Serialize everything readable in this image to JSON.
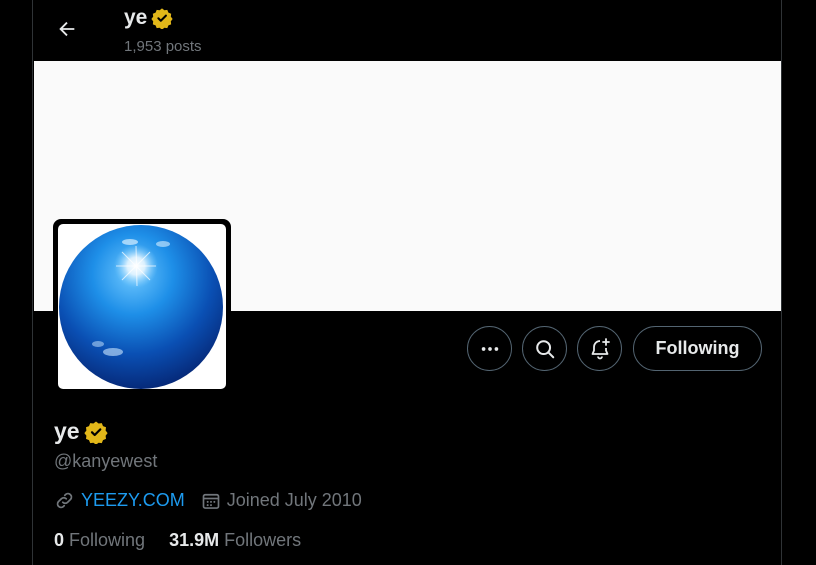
{
  "header": {
    "name": "ye",
    "post_count": "1,953 posts"
  },
  "profile": {
    "name": "ye",
    "handle": "@kanyewest",
    "website": "YEEZY.COM",
    "joined": "Joined July 2010",
    "following_count": "0",
    "following_label": "Following",
    "followers_count": "31.9M",
    "followers_label": "Followers"
  },
  "actions": {
    "follow_label": "Following",
    "more_icon": "more-icon",
    "search_icon": "search-icon",
    "notify_icon": "bell-plus-icon"
  },
  "colors": {
    "verified": "#e2b719",
    "link": "#1d9bf0",
    "muted": "#71767b",
    "banner": "#fafafa"
  }
}
